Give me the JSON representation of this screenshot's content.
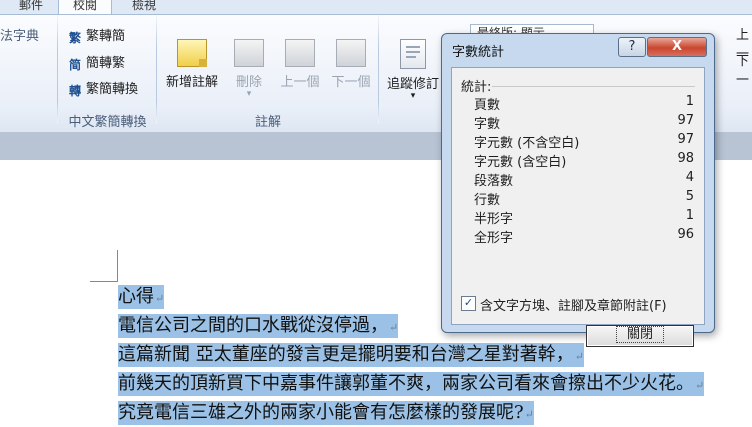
{
  "tabs": [
    "郵件",
    "校閱",
    "檢視"
  ],
  "ribbon": {
    "partial_left_label": "法字典",
    "chinese_conversion": {
      "items": [
        {
          "label": "繁轉簡",
          "icon": "trad-to-simp-icon"
        },
        {
          "label": "簡轉繁",
          "icon": "simp-to-trad-icon"
        },
        {
          "label": "繁簡轉換",
          "icon": "convert-icon"
        }
      ],
      "group_label": "中文繁簡轉換"
    },
    "comments": {
      "buttons": [
        {
          "label": "新增註解",
          "enabled": true
        },
        {
          "label": "刪除",
          "enabled": false
        },
        {
          "label": "上一個",
          "enabled": false
        },
        {
          "label": "下一個",
          "enabled": false
        }
      ],
      "group_label": "註解"
    },
    "tracking": {
      "track_changes_label": "追蹤修訂",
      "display_dropdown": "最終版: 顯示"
    },
    "right_partial": [
      "上一",
      "下一"
    ]
  },
  "document": {
    "lines": [
      "心得",
      "電信公司之間的口水戰從沒停過，",
      "這篇新聞  亞太董座的發言更是擺明要和台灣之星對著幹，",
      "前幾天的頂新買下中嘉事件讓郭董不爽，兩家公司看來會擦出不少火花。",
      "究竟電信三雄之外的兩家小能會有怎麼樣的發展呢?"
    ]
  },
  "dialog": {
    "title": "字數統計",
    "help_label": "?",
    "close_label": "X",
    "stats_label": "統計:",
    "stats": [
      {
        "label": "頁數",
        "value": "1"
      },
      {
        "label": "字數",
        "value": "97"
      },
      {
        "label": "字元數 (不含空白)",
        "value": "97"
      },
      {
        "label": "字元數 (含空白)",
        "value": "98"
      },
      {
        "label": "段落數",
        "value": "4"
      },
      {
        "label": "行數",
        "value": "5"
      },
      {
        "label": "半形字",
        "value": "1"
      },
      {
        "label": "全形字",
        "value": "96"
      }
    ],
    "checkbox_label": "含文字方塊、註腳及章節附註(F)",
    "checkbox_checked": true,
    "close_button_label": "關閉"
  }
}
